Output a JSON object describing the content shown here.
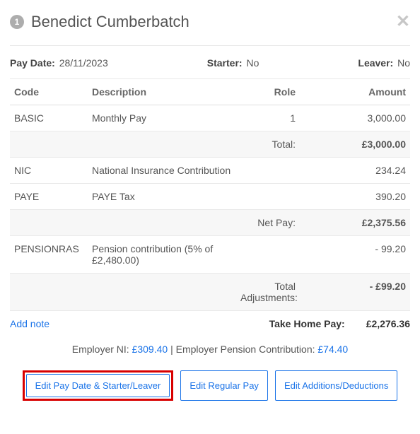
{
  "header": {
    "step_number": "1",
    "employee_name": "Benedict Cumberbatch"
  },
  "meta": {
    "pay_date_label": "Pay Date:",
    "pay_date_value": "28/11/2023",
    "starter_label": "Starter:",
    "starter_value": "No",
    "leaver_label": "Leaver:",
    "leaver_value": "No"
  },
  "table": {
    "head": {
      "code": "Code",
      "description": "Description",
      "role": "Role",
      "amount": "Amount"
    },
    "rows": [
      {
        "code": "BASIC",
        "description": "Monthly Pay",
        "role": "1",
        "amount": "3,000.00"
      }
    ],
    "totals1": {
      "label": "Total:",
      "value": "£3,000.00"
    },
    "rows2": [
      {
        "code": "NIC",
        "description": "National Insurance Contribution",
        "role": "",
        "amount": "234.24"
      },
      {
        "code": "PAYE",
        "description": "PAYE Tax",
        "role": "",
        "amount": "390.20"
      }
    ],
    "totals2": {
      "label": "Net Pay:",
      "value": "£2,375.56"
    },
    "rows3": [
      {
        "code": "PENSIONRAS",
        "description": "Pension contribution (5% of £2,480.00)",
        "role": "",
        "amount": "- 99.20"
      }
    ],
    "totals3": {
      "label": "Total Adjustments:",
      "value": "- £99.20"
    }
  },
  "footer": {
    "add_note": "Add note",
    "take_home_label": "Take Home Pay:",
    "take_home_value": "£2,276.36"
  },
  "employer": {
    "ni_label": "Employer NI: ",
    "ni_value": "£309.40",
    "separator": " | ",
    "pension_label": "Employer Pension Contribution: ",
    "pension_value": "£74.40"
  },
  "buttons": {
    "edit_pay_date": "Edit Pay Date & Starter/Leaver",
    "edit_regular": "Edit Regular Pay",
    "edit_additions": "Edit Additions/Deductions"
  }
}
